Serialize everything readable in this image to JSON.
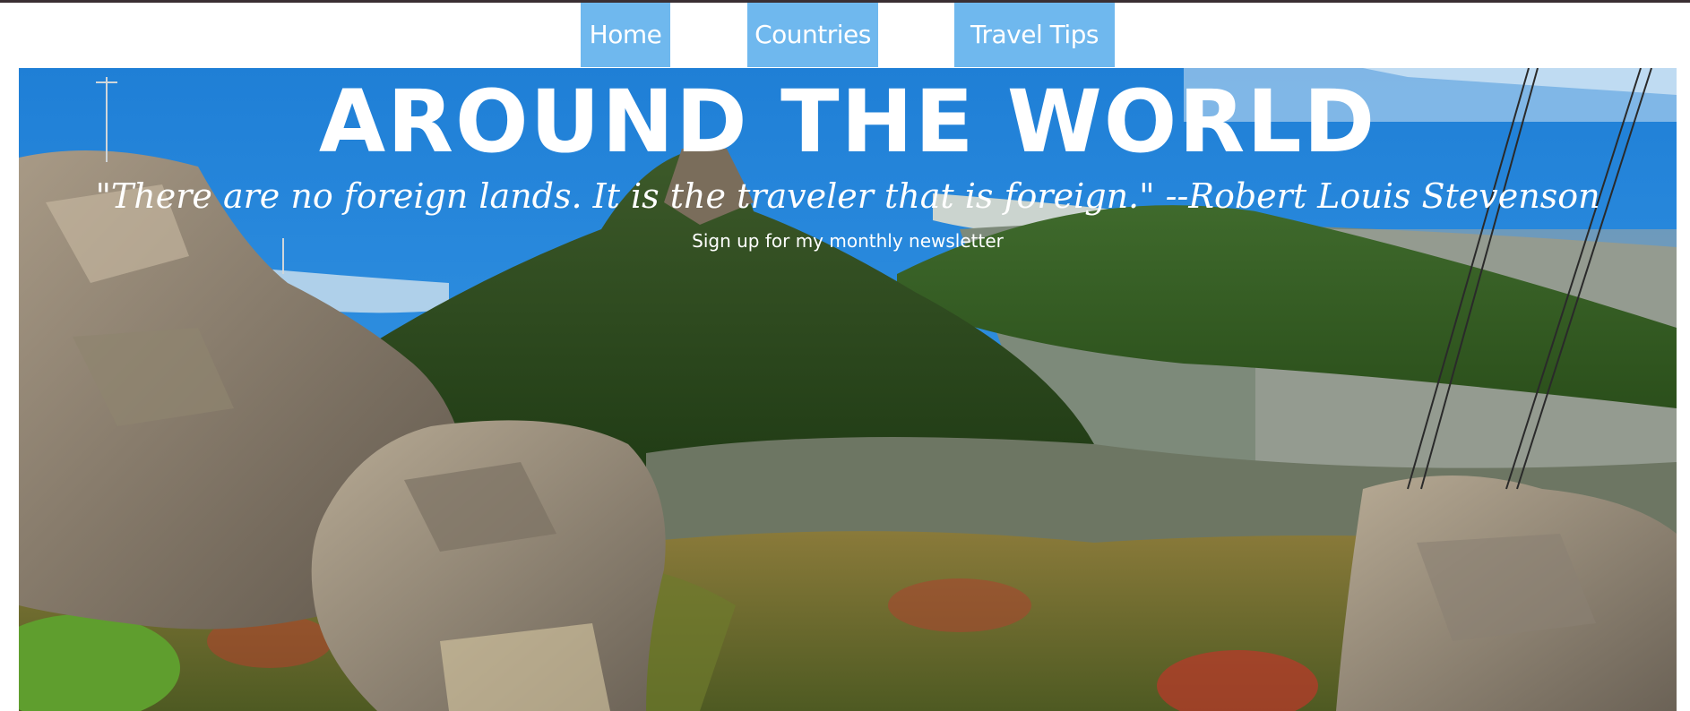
{
  "nav": {
    "items": [
      {
        "label": "Home"
      },
      {
        "label": "Countries"
      },
      {
        "label": "Travel Tips"
      }
    ]
  },
  "hero": {
    "title": "AROUND THE WORLD",
    "quote": "\"There are no foreign lands. It is the traveler that is foreign.\" --Robert Louis Stevenson",
    "signup_link": "Sign up for my monthly newsletter",
    "image_subject": "mountain-landscape-photo"
  },
  "colors": {
    "nav_background": "#6fb8ee",
    "nav_text": "#ffffff",
    "top_border": "#3a2f33",
    "hero_text": "#ffffff"
  }
}
